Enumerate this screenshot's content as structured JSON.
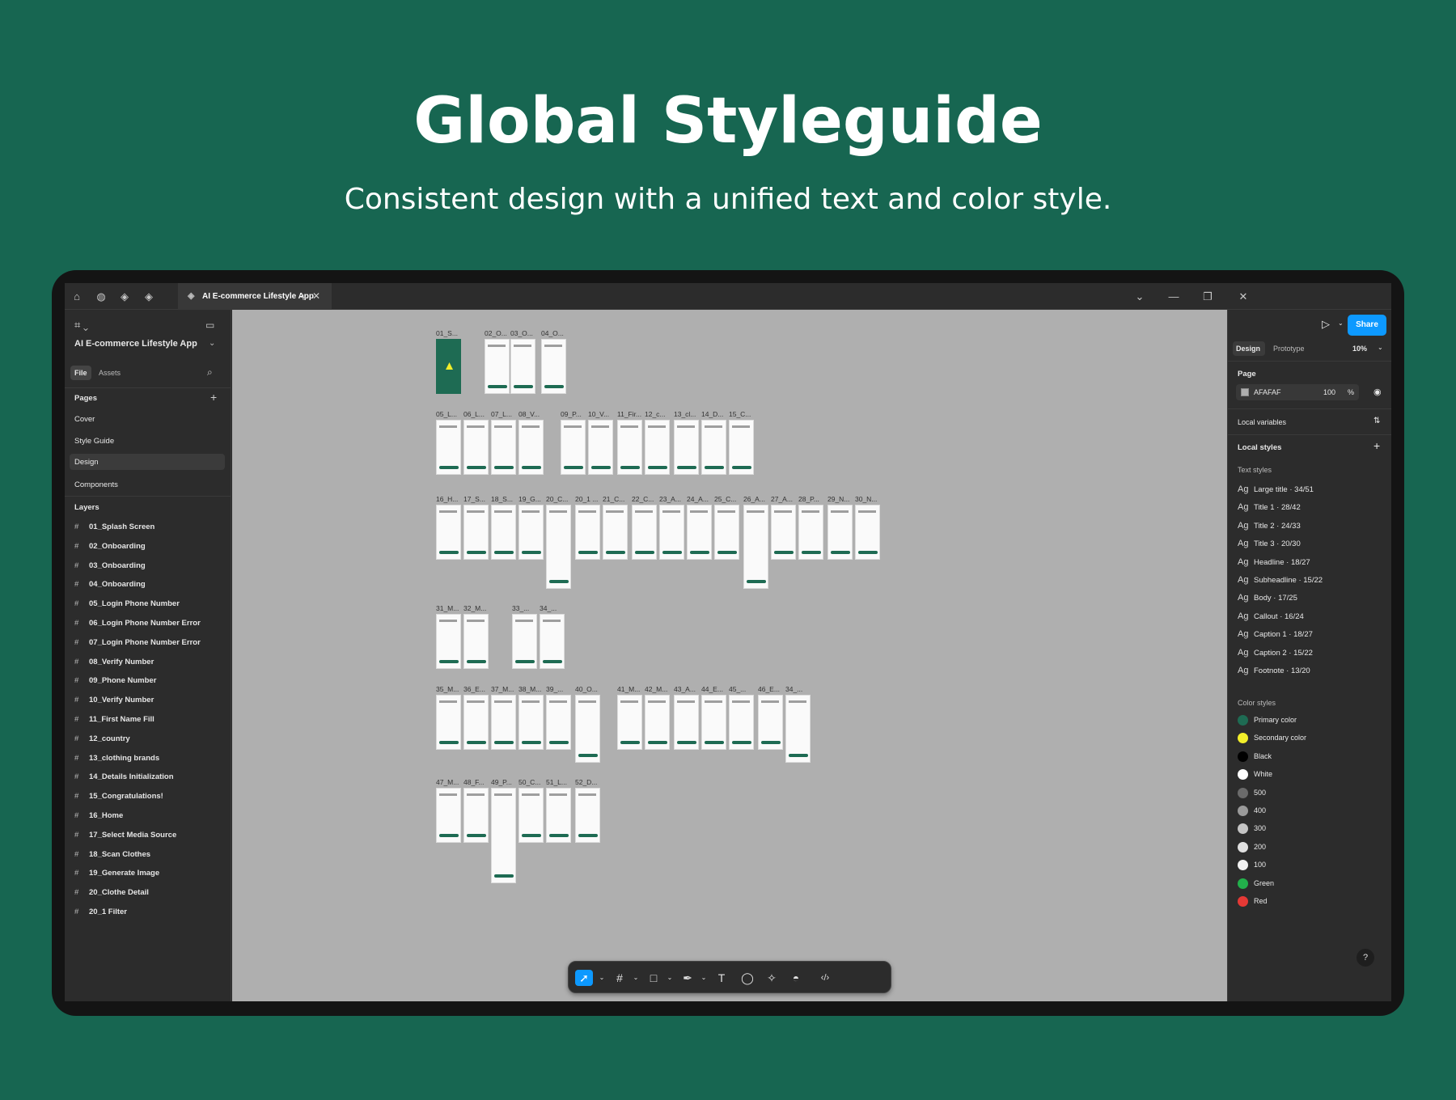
{
  "hero": {
    "title": "Global Styleguide",
    "subtitle": "Consistent design with a unified text and color style."
  },
  "window": {
    "tab_title": "AI E-commerce Lifestyle App",
    "new_tab": "+",
    "controls": [
      "⌄",
      "—",
      "❐",
      "✕"
    ]
  },
  "left_panel": {
    "project_name": "AI E-commerce Lifestyle App",
    "tab_file": "File",
    "tab_assets": "Assets",
    "pages_heading": "Pages",
    "pages": [
      "Cover",
      "Style Guide",
      "Design",
      "Components"
    ],
    "selected_page": "Design",
    "layers_heading": "Layers",
    "layers": [
      "01_Splash Screen",
      "02_Onboarding",
      "03_Onboarding",
      "04_Onboarding",
      "05_Login Phone Number",
      "06_Login Phone Number Error",
      "07_Login Phone Number Error",
      "08_Verify Number",
      "09_Phone Number",
      "10_Verify Number",
      "11_First Name Fill",
      "12_country",
      "13_clothing brands",
      "14_Details Initialization",
      "15_Congratulations!",
      "16_Home",
      "17_Select Media Source",
      "18_Scan Clothes",
      "19_Generate Image",
      "20_Clothe Detail",
      "20_1 Filter"
    ]
  },
  "canvas": {
    "frame_labels": {
      "row1": [
        "01_S...",
        "02_O...",
        "03_O...",
        "04_O..."
      ],
      "row2": [
        "05_L...",
        "06_L...",
        "07_L...",
        "08_V...",
        "09_P...",
        "10_V...",
        "11_Fir...",
        "12_c...",
        "13_cl...",
        "14_D...",
        "15_C..."
      ],
      "row3": [
        "16_H...",
        "17_S...",
        "18_S...",
        "19_G...",
        "20_C...",
        "20_1 ...",
        "21_C...",
        "22_C...",
        "23_A...",
        "24_A...",
        "25_C...",
        "26_A...",
        "27_A...",
        "28_P...",
        "29_N...",
        "30_N..."
      ],
      "row4": [
        "31_M...",
        "32_M...",
        "33_...",
        "34_..."
      ],
      "row5": [
        "35_M...",
        "36_E...",
        "37_M...",
        "38_M...",
        "39_...",
        "40_O...",
        "41_M...",
        "42_M...",
        "43_A...",
        "44_E...",
        "45_...",
        "46_E...",
        "34_..."
      ],
      "row6": [
        "47_M...",
        "48_F...",
        "49_P...",
        "50_C...",
        "51_L...",
        "52_D..."
      ]
    }
  },
  "right_panel": {
    "share_label": "Share",
    "tab_design": "Design",
    "tab_prototype": "Prototype",
    "zoom": "10%",
    "page_heading": "Page",
    "page_color_hex": "AFAFAF",
    "page_opacity": "100",
    "page_opacity_unit": "%",
    "local_variables": "Local variables",
    "local_styles": "Local styles",
    "text_styles_heading": "Text styles",
    "text_styles": [
      {
        "ag": "Ag",
        "name": "Large title · 34/51"
      },
      {
        "ag": "Ag",
        "name": "Title 1 · 28/42"
      },
      {
        "ag": "Ag",
        "name": "Title 2 · 24/33"
      },
      {
        "ag": "Ag",
        "name": "Title 3 · 20/30"
      },
      {
        "ag": "Ag",
        "name": "Headline · 18/27"
      },
      {
        "ag": "Ag",
        "name": "Subheadline · 15/22"
      },
      {
        "ag": "Ag",
        "name": "Body · 17/25"
      },
      {
        "ag": "Ag",
        "name": "Callout · 16/24"
      },
      {
        "ag": "Ag",
        "name": "Caption 1 · 18/27"
      },
      {
        "ag": "Ag",
        "name": "Caption 2 · 15/22"
      },
      {
        "ag": "Ag",
        "name": "Footnote · 13/20"
      }
    ],
    "color_styles_heading": "Color styles",
    "color_styles": [
      {
        "name": "Primary color",
        "color": "#1e6b53"
      },
      {
        "name": "Secondary color",
        "color": "#f2ee2a"
      },
      {
        "name": "Black",
        "color": "#000000"
      },
      {
        "name": "White",
        "color": "#ffffff"
      },
      {
        "name": "500",
        "color": "#6b6b6b"
      },
      {
        "name": "400",
        "color": "#9a9a9a"
      },
      {
        "name": "300",
        "color": "#c4c4c4"
      },
      {
        "name": "200",
        "color": "#e0e0e0"
      },
      {
        "name": "100",
        "color": "#f2f2f2"
      },
      {
        "name": "Green",
        "color": "#22b04b"
      },
      {
        "name": "Red",
        "color": "#e53935"
      }
    ],
    "help": "?"
  },
  "colors": {
    "background": "#176651",
    "accent": "#0d99ff",
    "primary_green": "#1e6b53",
    "canvas": "#afafaf"
  }
}
